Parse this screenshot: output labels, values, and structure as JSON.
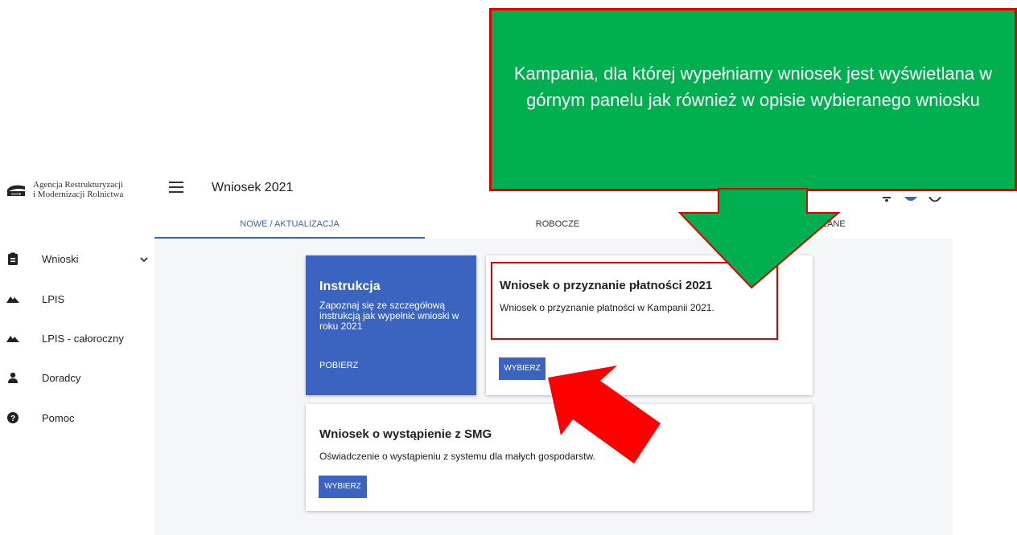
{
  "sidebar": {
    "logo": {
      "line1": "Agencja Restrukturyzacji",
      "line2": "i Modernizacji Rolnictwa",
      "mark": "ARiMR"
    },
    "items": [
      {
        "label": "Wnioski",
        "icon": "clipboard-icon",
        "expandable": true
      },
      {
        "label": "LPIS",
        "icon": "terrain-icon"
      },
      {
        "label": "LPIS - całoroczny",
        "icon": "terrain-icon"
      },
      {
        "label": "Doradcy",
        "icon": "person-icon"
      },
      {
        "label": "Pomoc",
        "icon": "help-icon"
      }
    ]
  },
  "header": {
    "title": "Wniosek 2021"
  },
  "tabs": [
    {
      "label": "NOWE / AKTUALIZACJA",
      "active": true
    },
    {
      "label": "ROBOCZE",
      "active": false
    },
    {
      "label": "YSŁANE",
      "active": false
    }
  ],
  "instruction_card": {
    "title": "Instrukcja",
    "description": "Zapoznaj się ze szczegółową instrukcją jak wypełnić wnioski w roku 2021",
    "button": "POBIERZ"
  },
  "cards": [
    {
      "title": "Wniosek o przyznanie płatności 2021",
      "description": "Wniosek o przyznanie płatności w Kampanii 2021.",
      "button": "WYBIERZ"
    },
    {
      "title": "Wniosek o wystąpienie z SMG",
      "description": "Oświadczenie o wystąpieniu z systemu dla małych gospodarstw.",
      "button": "WYBIERZ"
    }
  ],
  "annotation": {
    "text": "Kampania, dla której wypełniamy wniosek jest wyświetlana w górnym panelu jak również w opisie wybieranego wniosku"
  },
  "colors": {
    "primary": "#3b64c0",
    "callout_fill": "#00b050",
    "annotation_red": "#e00000",
    "content_bg": "#f5f6f8"
  }
}
